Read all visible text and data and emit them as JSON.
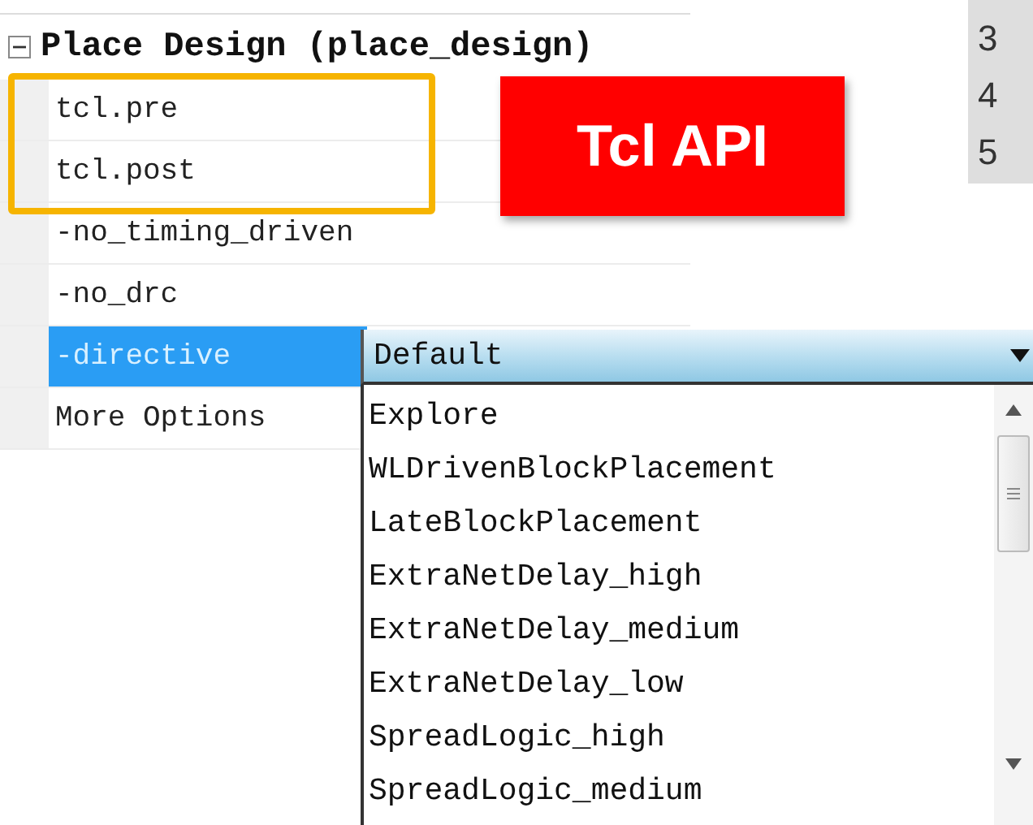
{
  "section": {
    "title": "Place Design (place_design)",
    "expanded": true
  },
  "properties": [
    {
      "name": "tcl.pre",
      "selected": false
    },
    {
      "name": "tcl.post",
      "selected": false
    },
    {
      "name": "-no_timing_driven",
      "selected": false
    },
    {
      "name": "-no_drc",
      "selected": false
    },
    {
      "name": "-directive",
      "selected": true
    },
    {
      "name": "More Options",
      "selected": false
    }
  ],
  "callout": {
    "label": "Tcl API"
  },
  "line_numbers": [
    "3",
    "4",
    "5"
  ],
  "directive_combo": {
    "value": "Default",
    "options": [
      "Explore",
      "WLDrivenBlockPlacement",
      "LateBlockPlacement",
      "ExtraNetDelay_high",
      "ExtraNetDelay_medium",
      "ExtraNetDelay_low",
      "SpreadLogic_high",
      "SpreadLogic_medium"
    ]
  }
}
